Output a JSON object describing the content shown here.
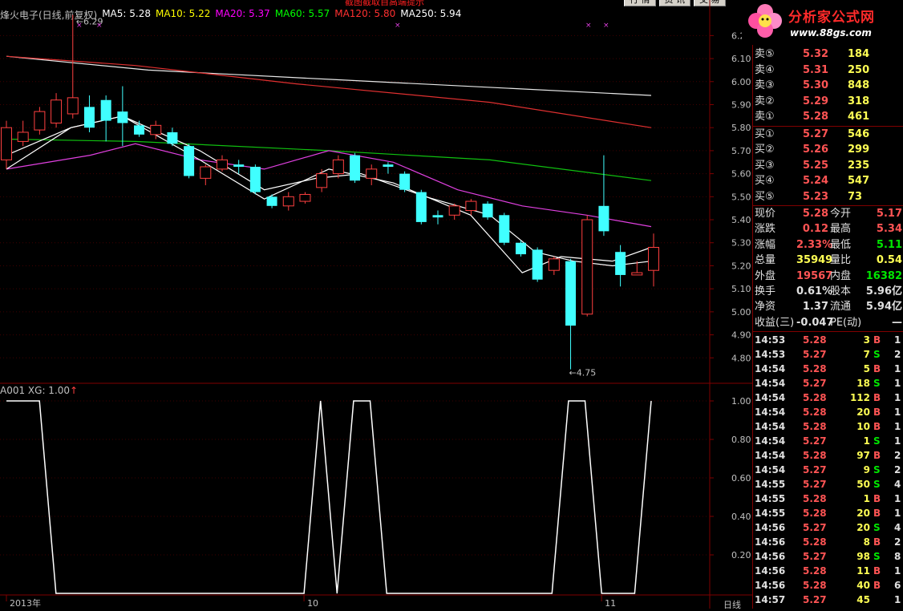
{
  "top": {
    "notice": "截图截取自高端提示",
    "buttons": [
      "行 情",
      "资 讯",
      "交 易"
    ]
  },
  "header": {
    "stock": "烽火电子(日线,前复权)",
    "ma5": "MA5: 5.28",
    "ma10": "MA10: 5.22",
    "ma20": "MA20: 5.37",
    "ma60": "MA60: 5.57",
    "ma120": "MA120: 5.80",
    "ma250": "MA250: 5.94",
    "colors": {
      "stock": "#c0c0c0",
      "ma5": "#ffffff",
      "ma10": "#ffff00",
      "ma20": "#ff00ff",
      "ma60": "#00ff00",
      "ma120": "#ff3030",
      "ma250": "#ffffff"
    }
  },
  "logo": {
    "title": "分析家公式网",
    "url": "www.88gs.com"
  },
  "price_chart": {
    "y_ticks": [
      "6.20",
      "6.10",
      "6.00",
      "5.90",
      "5.80",
      "5.70",
      "5.60",
      "5.50",
      "5.40",
      "5.30",
      "5.20",
      "5.10",
      "5.00",
      "4.90",
      "4.80"
    ],
    "high_label": "6.29",
    "low_label": "4.75",
    "candles": [
      {
        "o": 5.66,
        "c": 5.8,
        "h": 5.83,
        "l": 5.62,
        "up": true
      },
      {
        "o": 5.74,
        "c": 5.78,
        "h": 5.83,
        "l": 5.72,
        "up": true
      },
      {
        "o": 5.79,
        "c": 5.87,
        "h": 5.89,
        "l": 5.77,
        "up": true
      },
      {
        "o": 5.82,
        "c": 5.92,
        "h": 5.95,
        "l": 5.8,
        "up": true
      },
      {
        "o": 5.86,
        "c": 5.93,
        "h": 6.29,
        "l": 5.84,
        "up": true
      },
      {
        "o": 5.89,
        "c": 5.8,
        "h": 5.94,
        "l": 5.78,
        "up": false
      },
      {
        "o": 5.92,
        "c": 5.83,
        "h": 5.94,
        "l": 5.74,
        "up": false
      },
      {
        "o": 5.87,
        "c": 5.82,
        "h": 5.98,
        "l": 5.72,
        "up": false
      },
      {
        "o": 5.81,
        "c": 5.77,
        "h": 5.83,
        "l": 5.76,
        "up": false
      },
      {
        "o": 5.77,
        "c": 5.81,
        "h": 5.83,
        "l": 5.75,
        "up": true
      },
      {
        "o": 5.78,
        "c": 5.73,
        "h": 5.8,
        "l": 5.72,
        "up": false
      },
      {
        "o": 5.72,
        "c": 5.59,
        "h": 5.73,
        "l": 5.58,
        "up": false
      },
      {
        "o": 5.58,
        "c": 5.63,
        "h": 5.64,
        "l": 5.55,
        "up": true
      },
      {
        "o": 5.62,
        "c": 5.66,
        "h": 5.68,
        "l": 5.61,
        "up": true
      },
      {
        "o": 5.64,
        "c": 5.63,
        "h": 5.66,
        "l": 5.6,
        "up": false
      },
      {
        "o": 5.63,
        "c": 5.52,
        "h": 5.64,
        "l": 5.51,
        "up": false
      },
      {
        "o": 5.5,
        "c": 5.46,
        "h": 5.51,
        "l": 5.45,
        "up": false
      },
      {
        "o": 5.46,
        "c": 5.5,
        "h": 5.52,
        "l": 5.44,
        "up": true
      },
      {
        "o": 5.48,
        "c": 5.51,
        "h": 5.52,
        "l": 5.47,
        "up": true
      },
      {
        "o": 5.54,
        "c": 5.6,
        "h": 5.62,
        "l": 5.52,
        "up": true
      },
      {
        "o": 5.6,
        "c": 5.66,
        "h": 5.68,
        "l": 5.58,
        "up": true
      },
      {
        "o": 5.68,
        "c": 5.57,
        "h": 5.69,
        "l": 5.56,
        "up": false
      },
      {
        "o": 5.58,
        "c": 5.62,
        "h": 5.64,
        "l": 5.55,
        "up": true
      },
      {
        "o": 5.64,
        "c": 5.63,
        "h": 5.65,
        "l": 5.6,
        "up": false
      },
      {
        "o": 5.6,
        "c": 5.53,
        "h": 5.61,
        "l": 5.52,
        "up": false
      },
      {
        "o": 5.52,
        "c": 5.39,
        "h": 5.53,
        "l": 5.38,
        "up": false
      },
      {
        "o": 5.42,
        "c": 5.41,
        "h": 5.44,
        "l": 5.38,
        "up": false
      },
      {
        "o": 5.42,
        "c": 5.46,
        "h": 5.47,
        "l": 5.4,
        "up": true
      },
      {
        "o": 5.44,
        "c": 5.48,
        "h": 5.49,
        "l": 5.42,
        "up": true
      },
      {
        "o": 5.47,
        "c": 5.41,
        "h": 5.48,
        "l": 5.4,
        "up": false
      },
      {
        "o": 5.42,
        "c": 5.3,
        "h": 5.43,
        "l": 5.29,
        "up": false
      },
      {
        "o": 5.3,
        "c": 5.25,
        "h": 5.31,
        "l": 5.24,
        "up": false
      },
      {
        "o": 5.27,
        "c": 5.14,
        "h": 5.28,
        "l": 5.13,
        "up": false
      },
      {
        "o": 5.18,
        "c": 5.23,
        "h": 5.24,
        "l": 5.16,
        "up": true
      },
      {
        "o": 5.22,
        "c": 4.94,
        "h": 5.23,
        "l": 4.75,
        "up": false
      },
      {
        "o": 4.99,
        "c": 5.4,
        "h": 5.42,
        "l": 4.98,
        "up": true
      },
      {
        "o": 5.46,
        "c": 5.35,
        "h": 5.68,
        "l": 5.33,
        "up": false
      },
      {
        "o": 5.26,
        "c": 5.16,
        "h": 5.29,
        "l": 5.11,
        "up": false
      },
      {
        "o": 5.16,
        "c": 5.17,
        "h": 5.22,
        "l": 5.16,
        "up": true
      },
      {
        "o": 5.18,
        "c": 5.28,
        "h": 5.34,
        "l": 5.11,
        "up": true
      }
    ],
    "ma250_pts": [
      [
        0,
        6.11
      ],
      [
        0.22,
        6.05
      ],
      [
        0.5,
        6.01
      ],
      [
        1,
        5.94
      ]
    ],
    "ma120_pts": [
      [
        0,
        6.11
      ],
      [
        0.2,
        6.07
      ],
      [
        0.45,
        5.99
      ],
      [
        0.75,
        5.91
      ],
      [
        1,
        5.8
      ]
    ],
    "ma60_pts": [
      [
        0,
        5.75
      ],
      [
        0.2,
        5.74
      ],
      [
        0.5,
        5.7
      ],
      [
        0.75,
        5.66
      ],
      [
        1,
        5.57
      ]
    ],
    "ma20_pts": [
      [
        0,
        5.62
      ],
      [
        0.13,
        5.68
      ],
      [
        0.2,
        5.73
      ],
      [
        0.3,
        5.66
      ],
      [
        0.4,
        5.62
      ],
      [
        0.5,
        5.7
      ],
      [
        0.6,
        5.65
      ],
      [
        0.7,
        5.53
      ],
      [
        0.8,
        5.46
      ],
      [
        0.9,
        5.42
      ],
      [
        1,
        5.37
      ]
    ],
    "ma10_pts": [
      [
        0,
        5.68
      ],
      [
        0.1,
        5.8
      ],
      [
        0.18,
        5.85
      ],
      [
        0.3,
        5.7
      ],
      [
        0.4,
        5.53
      ],
      [
        0.48,
        5.58
      ],
      [
        0.55,
        5.6
      ],
      [
        0.65,
        5.5
      ],
      [
        0.75,
        5.42
      ],
      [
        0.82,
        5.26
      ],
      [
        0.88,
        5.22
      ],
      [
        0.94,
        5.2
      ],
      [
        1,
        5.22
      ]
    ],
    "ma5_pts": [
      [
        0,
        5.62
      ],
      [
        0.1,
        5.8
      ],
      [
        0.18,
        5.85
      ],
      [
        0.3,
        5.66
      ],
      [
        0.4,
        5.49
      ],
      [
        0.5,
        5.62
      ],
      [
        0.6,
        5.56
      ],
      [
        0.72,
        5.42
      ],
      [
        0.8,
        5.17
      ],
      [
        0.86,
        5.24
      ],
      [
        0.94,
        5.22
      ],
      [
        1,
        5.28
      ]
    ]
  },
  "indicator": {
    "header": "A001  XG: 1.00",
    "y_ticks": [
      "1.00",
      "0.80",
      "0.60",
      "0.40",
      "0.20"
    ],
    "xg": [
      1,
      1,
      1,
      0,
      0,
      0,
      0,
      0,
      0,
      0,
      0,
      0,
      0,
      0,
      0,
      0,
      0,
      0,
      0,
      1,
      0,
      1,
      1,
      0,
      0,
      0,
      0,
      0,
      0,
      0,
      0,
      0,
      0,
      0,
      1,
      1,
      0,
      0,
      0,
      1
    ],
    "x_labels": [
      {
        "t": "2013年",
        "i": 0
      },
      {
        "t": "10",
        "i": 18
      },
      {
        "t": "11",
        "i": 36
      }
    ],
    "period": "日线"
  },
  "quote": {
    "asks": [
      {
        "label": "卖⑤",
        "price": "5.32",
        "vol": "184"
      },
      {
        "label": "卖④",
        "price": "5.31",
        "vol": "250"
      },
      {
        "label": "卖③",
        "price": "5.30",
        "vol": "848"
      },
      {
        "label": "卖②",
        "price": "5.29",
        "vol": "318"
      },
      {
        "label": "卖①",
        "price": "5.28",
        "vol": "461"
      }
    ],
    "bids": [
      {
        "label": "买①",
        "price": "5.27",
        "vol": "546"
      },
      {
        "label": "买②",
        "price": "5.26",
        "vol": "299"
      },
      {
        "label": "买③",
        "price": "5.25",
        "vol": "235"
      },
      {
        "label": "买④",
        "price": "5.24",
        "vol": "547"
      },
      {
        "label": "买⑤",
        "price": "5.23",
        "vol": "73"
      }
    ],
    "stats": [
      {
        "l1": "现价",
        "v1": "5.28",
        "l2": "今开",
        "v2": "5.17",
        "c1": "red",
        "c2": "red"
      },
      {
        "l1": "涨跌",
        "v1": "0.12",
        "l2": "最高",
        "v2": "5.34",
        "c1": "red",
        "c2": "red"
      },
      {
        "l1": "涨幅",
        "v1": "2.33%",
        "l2": "最低",
        "v2": "5.11",
        "c1": "red",
        "c2": "green"
      },
      {
        "l1": "总量",
        "v1": "35949",
        "l2": "量比",
        "v2": "0.54",
        "c1": "yel",
        "c2": "yel"
      },
      {
        "l1": "外盘",
        "v1": "19567",
        "l2": "内盘",
        "v2": "16382",
        "c1": "red",
        "c2": "green"
      },
      {
        "l1": "换手",
        "v1": "0.61%",
        "l2": "股本",
        "v2": "5.96亿",
        "c1": "wht",
        "c2": "wht"
      },
      {
        "l1": "净资",
        "v1": "1.37",
        "l2": "流通",
        "v2": "5.94亿",
        "c1": "wht",
        "c2": "wht"
      },
      {
        "l1": "收益(三)",
        "v1": "-0.047",
        "l2": "PE(动)",
        "v2": "—",
        "c1": "wht",
        "c2": "wht"
      }
    ],
    "ticks": [
      {
        "t": "14:53",
        "p": "5.28",
        "v": "3",
        "bs": "B",
        "n": "1"
      },
      {
        "t": "14:53",
        "p": "5.27",
        "v": "7",
        "bs": "S",
        "n": "2"
      },
      {
        "t": "14:54",
        "p": "5.28",
        "v": "5",
        "bs": "B",
        "n": "1"
      },
      {
        "t": "14:54",
        "p": "5.27",
        "v": "18",
        "bs": "S",
        "n": "1"
      },
      {
        "t": "14:54",
        "p": "5.28",
        "v": "112",
        "bs": "B",
        "n": "1"
      },
      {
        "t": "14:54",
        "p": "5.28",
        "v": "20",
        "bs": "B",
        "n": "1"
      },
      {
        "t": "14:54",
        "p": "5.28",
        "v": "10",
        "bs": "B",
        "n": "1"
      },
      {
        "t": "14:54",
        "p": "5.27",
        "v": "1",
        "bs": "S",
        "n": "1"
      },
      {
        "t": "14:54",
        "p": "5.28",
        "v": "97",
        "bs": "B",
        "n": "2"
      },
      {
        "t": "14:54",
        "p": "5.27",
        "v": "9",
        "bs": "S",
        "n": "2"
      },
      {
        "t": "14:55",
        "p": "5.27",
        "v": "50",
        "bs": "S",
        "n": "4"
      },
      {
        "t": "14:55",
        "p": "5.28",
        "v": "1",
        "bs": "B",
        "n": "1"
      },
      {
        "t": "14:55",
        "p": "5.28",
        "v": "20",
        "bs": "B",
        "n": "1"
      },
      {
        "t": "14:56",
        "p": "5.27",
        "v": "20",
        "bs": "S",
        "n": "4"
      },
      {
        "t": "14:56",
        "p": "5.28",
        "v": "8",
        "bs": "B",
        "n": "2"
      },
      {
        "t": "14:56",
        "p": "5.27",
        "v": "98",
        "bs": "S",
        "n": "8"
      },
      {
        "t": "14:56",
        "p": "5.28",
        "v": "11",
        "bs": "B",
        "n": "1"
      },
      {
        "t": "14:56",
        "p": "5.28",
        "v": "40",
        "bs": "B",
        "n": "6"
      },
      {
        "t": "14:57",
        "p": "5.27",
        "v": "45",
        "bs": "",
        "n": "1"
      }
    ]
  }
}
